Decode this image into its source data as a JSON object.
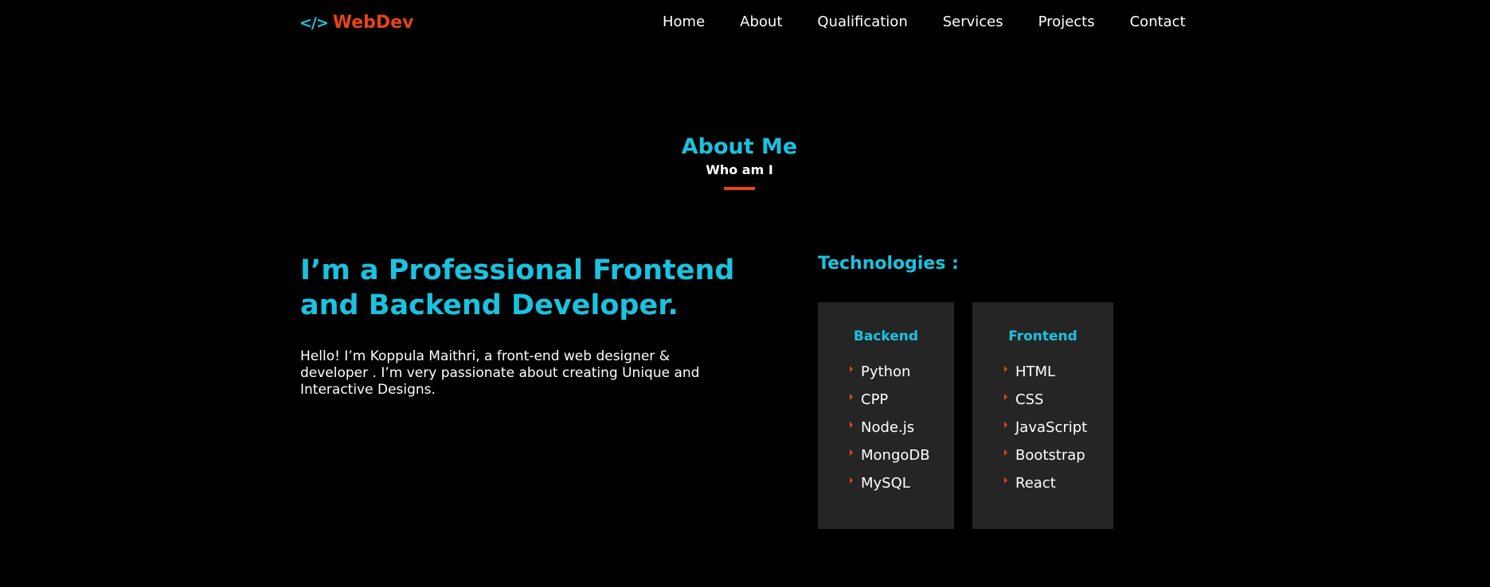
{
  "brand": {
    "logo_symbol": "</>",
    "name": "WebDev",
    "colors": {
      "accent": "#19c3e0",
      "brand": "#e8431a",
      "background": "#000000",
      "card": "#252525"
    }
  },
  "nav": {
    "items": [
      {
        "label": "Home"
      },
      {
        "label": "About"
      },
      {
        "label": "Qualification"
      },
      {
        "label": "Services"
      },
      {
        "label": "Projects"
      },
      {
        "label": "Contact"
      }
    ]
  },
  "section": {
    "title": "About Me",
    "subtitle": "Who am I"
  },
  "about": {
    "headline": "I’m a Professional Frontend and Backend Developer.",
    "intro": "Hello! I’m Koppula Maithri, a front-end web designer & developer . I’m very passionate about creating Unique and Interactive Designs."
  },
  "technologies": {
    "title": "Technologies :",
    "backend": {
      "title": "Backend",
      "items": [
        "Python",
        "CPP",
        "Node.js",
        "MongoDB",
        "MySQL"
      ]
    },
    "frontend": {
      "title": "Frontend",
      "items": [
        "HTML",
        "CSS",
        "JavaScript",
        "Bootstrap",
        "React"
      ]
    }
  }
}
